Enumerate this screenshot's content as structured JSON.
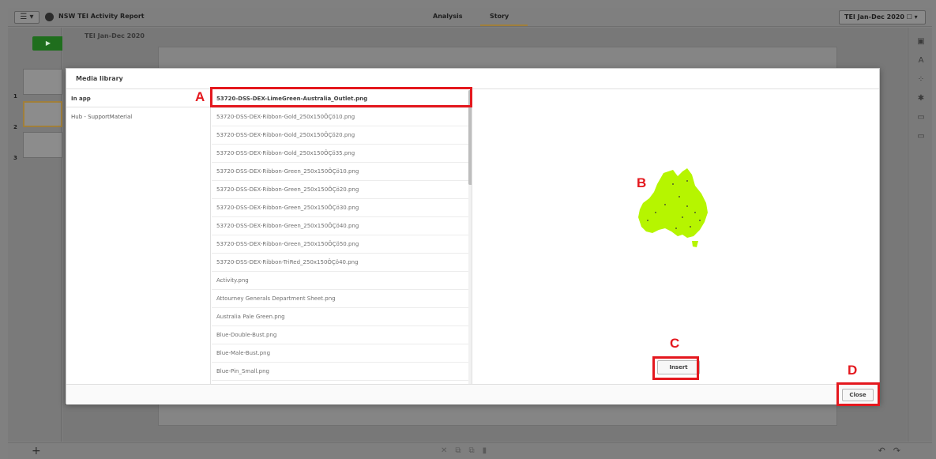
{
  "header": {
    "menu_label": "☰ ▾",
    "app_title": "NSW TEI Activity Report",
    "tabs": [
      {
        "label": "Analysis"
      },
      {
        "label": "Story"
      }
    ],
    "story_selector": "TEI Jan-Dec 2020 ☐ ▾"
  },
  "left_panel": {
    "play_label": "▶",
    "slides": [
      {
        "num": "1"
      },
      {
        "num": "2"
      },
      {
        "num": "3"
      }
    ]
  },
  "canvas": {
    "title": "TEI Jan-Dec 2020"
  },
  "bottom_bar": {
    "add_slide": "+",
    "undo": "↶",
    "redo": "↷"
  },
  "modal": {
    "title": "Media library",
    "folders": [
      {
        "label": "In app"
      },
      {
        "label": "Hub - SupportMaterial"
      }
    ],
    "files": [
      {
        "label": "53720-DSS-DEX-LimeGreen-Australia_Outlet.png"
      },
      {
        "label": "53720-DSS-DEX-Ribbon-Gold_250x150ÔÇö10.png"
      },
      {
        "label": "53720-DSS-DEX-Ribbon-Gold_250x150ÔÇö20.png"
      },
      {
        "label": "53720-DSS-DEX-Ribbon-Gold_250x150ÔÇö35.png"
      },
      {
        "label": "53720-DSS-DEX-Ribbon-Green_250x150ÔÇö10.png"
      },
      {
        "label": "53720-DSS-DEX-Ribbon-Green_250x150ÔÇö20.png"
      },
      {
        "label": "53720-DSS-DEX-Ribbon-Green_250x150ÔÇö30.png"
      },
      {
        "label": "53720-DSS-DEX-Ribbon-Green_250x150ÔÇö40.png"
      },
      {
        "label": "53720-DSS-DEX-Ribbon-Green_250x150ÔÇö50.png"
      },
      {
        "label": "53720-DSS-DEX-Ribbon-TriRed_250x150ÔÇö40.png"
      },
      {
        "label": "Activity.png"
      },
      {
        "label": "Attourney Generals Department Sheet.png"
      },
      {
        "label": "Australia Pale Green.png"
      },
      {
        "label": "Blue-Double-Bust.png"
      },
      {
        "label": "Blue-Male-Bust.png"
      },
      {
        "label": "Blue-Pin_Small.png"
      }
    ],
    "insert_label": "Insert",
    "close_label": "Close"
  },
  "callouts": {
    "a": "A",
    "b": "B",
    "c": "C",
    "d": "D"
  },
  "colors": {
    "callout_red": "#e4181e",
    "map_green": "#b6f500",
    "accent_gold": "#a07f3b"
  }
}
